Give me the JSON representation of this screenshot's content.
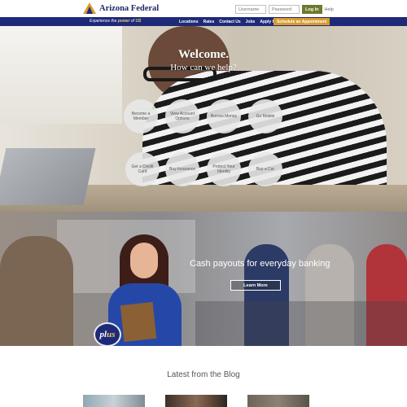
{
  "header": {
    "brand_name": "Arizona Federal",
    "login": {
      "username_placeholder": "Username",
      "password_placeholder": "Password",
      "login_label": "Log In",
      "help_label": "Help"
    }
  },
  "nav": {
    "tagline_prefix": "Experience the ",
    "tagline_power": "power",
    "tagline_of": " of ",
    "tagline_us": "US",
    "items": [
      "Locations",
      "Rates",
      "Contact Us",
      "Jobs",
      "Apply for Loan"
    ],
    "cta": "Schedule an Appointment"
  },
  "hero": {
    "title": "Welcome.",
    "subtitle": "How can we help?",
    "options": [
      "Become a Member",
      "View Account Options",
      "Borrow Money",
      "Go Mobile",
      "Get a Credit Card",
      "Buy Insurance",
      "Protect Your Identity",
      "Buy a Car"
    ]
  },
  "promo": {
    "badge_pl": "pl",
    "badge_us": "us",
    "headline": "Cash payouts for everyday banking",
    "button_label": "Learn More"
  },
  "blog": {
    "heading": "Latest from the Blog"
  },
  "colors": {
    "brand_navy": "#1e2a78",
    "accent_gold": "#d99a2b",
    "login_green": "#6b7a2c"
  }
}
